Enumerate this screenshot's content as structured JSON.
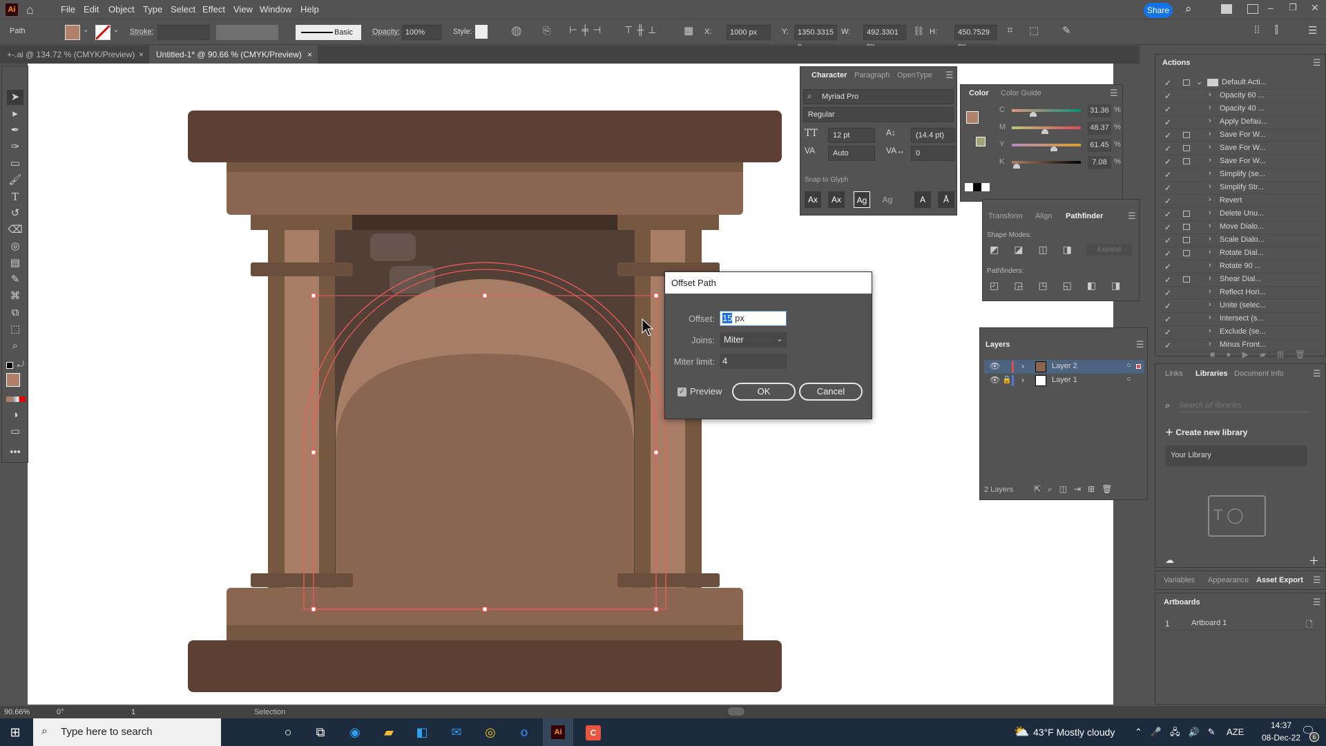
{
  "app": {
    "logo": "Ai",
    "menu": [
      "File",
      "Edit",
      "Object",
      "Type",
      "Select",
      "Effect",
      "View",
      "Window",
      "Help"
    ],
    "share": "Share"
  },
  "control": {
    "selection_type": "Path",
    "fill_color": "#b08068",
    "stroke_label": "Stroke:",
    "brush_label": "Basic",
    "opacity_label": "Opacity:",
    "opacity": "100%",
    "style_label": "Style:",
    "x_label": "X:",
    "x": "1000 px",
    "y_label": "Y:",
    "y": "1350.3315 p",
    "w_label": "W:",
    "w": "492.3301 px",
    "h_label": "H:",
    "h": "450.7529 px"
  },
  "tabs": [
    {
      "label": "+-.ai @ 134.72 % (CMYK/Preview)",
      "close": "×"
    },
    {
      "label": "Untitled-1* @ 90.66 % (CMYK/Preview)",
      "close": "×"
    }
  ],
  "character": {
    "tabs": [
      "Character",
      "Paragraph",
      "OpenType"
    ],
    "font": "Myriad Pro",
    "style": "Regular",
    "size": "12 pt",
    "leading": "(14.4 pt)",
    "kerning": "Auto",
    "tracking": "0",
    "snap_label": "Snap to Glyph"
  },
  "color": {
    "tabs": [
      "Color",
      "Color Guide"
    ],
    "channels": [
      {
        "label": "C",
        "value": "31.36",
        "pct": 31.36
      },
      {
        "label": "M",
        "value": "48.37",
        "pct": 48.37
      },
      {
        "label": "Y",
        "value": "61.45",
        "pct": 61.45
      },
      {
        "label": "K",
        "value": "7.08",
        "pct": 7.08
      }
    ],
    "unit": "%",
    "fill": "#b08068",
    "gamut": "#9fa272"
  },
  "pathfinder": {
    "tabs": [
      "Transform",
      "Align",
      "Pathfinder"
    ],
    "shape_modes": "Shape Modes:",
    "expand": "Expand",
    "pathfinders": "Pathfinders:"
  },
  "layers": {
    "title": "Layers",
    "rows": [
      {
        "name": "Layer 2",
        "color": "#e05050",
        "selected": true,
        "locked": false
      },
      {
        "name": "Layer 1",
        "color": "#4f7be0",
        "selected": false,
        "locked": true
      }
    ],
    "count": "2 Layers"
  },
  "actions": {
    "title": "Actions",
    "set": "Default Acti...",
    "items": [
      {
        "label": "Opacity 60 ...",
        "dialog": false
      },
      {
        "label": "Opacity 40 ...",
        "dialog": false
      },
      {
        "label": "Apply Defau...",
        "dialog": false
      },
      {
        "label": "Save For W...",
        "dialog": true
      },
      {
        "label": "Save For W...",
        "dialog": true
      },
      {
        "label": "Save For W...",
        "dialog": true
      },
      {
        "label": "Simplify (se...",
        "dialog": false
      },
      {
        "label": "Simplify Str...",
        "dialog": false
      },
      {
        "label": "Revert",
        "dialog": false
      },
      {
        "label": "Delete Unu...",
        "dialog": true
      },
      {
        "label": "Move Dialo...",
        "dialog": true
      },
      {
        "label": "Scale Dialo...",
        "dialog": true
      },
      {
        "label": "Rotate Dial...",
        "dialog": true
      },
      {
        "label": "Rotate 90 ...",
        "dialog": false
      },
      {
        "label": "Shear Dial...",
        "dialog": true
      },
      {
        "label": "Reflect Hori...",
        "dialog": false
      },
      {
        "label": "Unite (selec...",
        "dialog": false
      },
      {
        "label": "Intersect (s...",
        "dialog": false
      },
      {
        "label": "Exclude (se...",
        "dialog": false
      },
      {
        "label": "Minus Front...",
        "dialog": false
      }
    ]
  },
  "libraries": {
    "tabs": [
      "Links",
      "Libraries",
      "Document Info"
    ],
    "search_placeholder": "Search all libraries",
    "create": "Create new library",
    "your_library": "Your Library"
  },
  "bottom_tabs": [
    "Variables",
    "Appearance",
    "Asset Export"
  ],
  "artboards": {
    "title": "Artboards",
    "rows": [
      {
        "num": "1",
        "name": "Artboard 1"
      }
    ]
  },
  "dialog": {
    "title": "Offset Path",
    "offset_label": "Offset:",
    "offset_value": "15",
    "offset_unit": "px",
    "joins_label": "Joins:",
    "joins_value": "Miter",
    "miter_label": "Miter limit:",
    "miter_value": "4",
    "preview_label": "Preview",
    "preview_checked": true,
    "ok": "OK",
    "cancel": "Cancel"
  },
  "status": {
    "zoom": "90.66%",
    "rotation": "0°",
    "artboard": "1",
    "tool": "Selection"
  },
  "taskbar": {
    "search_placeholder": "Type here to search",
    "weather": "43°F  Mostly cloudy",
    "lang": "AZE",
    "time": "14:37",
    "date": "08-Dec-22",
    "notifications": "6"
  }
}
